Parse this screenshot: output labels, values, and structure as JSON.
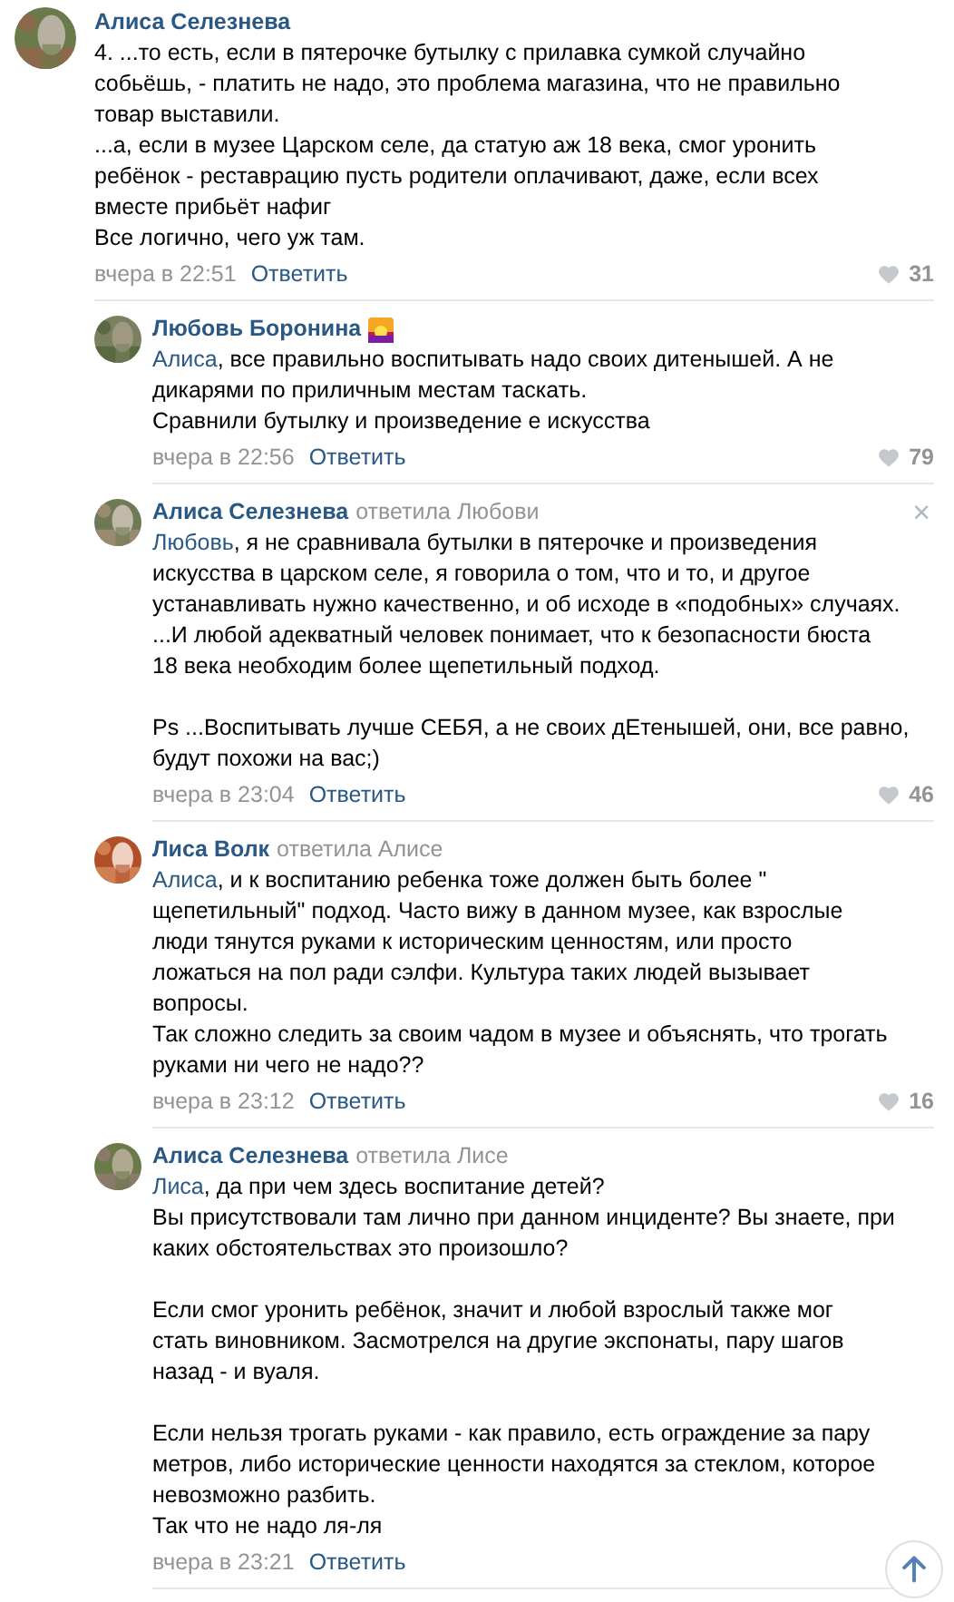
{
  "comment": {
    "author": "Алиса Селезнева",
    "avatar": {
      "kind": "picture"
    },
    "paragraphs": [
      {
        "text": "4. ...то есть, если в пятерочке бутылку с прилавка сумкой случайно\nсобьёшь, - платить не надо, это проблема магазина, что не правильно\nтовар выставили.\n...а, если в музее Царском селе, да статую аж 18 века, смог уронить\nребёнок - реставрацию пусть родители оплачивают, даже, если всех\nвместе прибьёт нафиг\nВсе логично, чего уж там."
      }
    ],
    "time": "вчера в 22:51",
    "reply": "Ответить",
    "likes": "31",
    "closable": false,
    "replies": [
      {
        "author": "Любовь Боронина",
        "closable": false,
        "avatar": {
          "kind": "picture"
        },
        "emoji": {
          "kind": "sunset"
        },
        "paragraphs": [
          {
            "mention": "Алиса",
            "text": ", все правильно воспитывать надо своих дитенышей. А не\nдикарями по приличным местам таскать.\nСравнили бутылку и произведение е искусства"
          }
        ],
        "time": "вчера в 22:56",
        "reply": "Ответить",
        "likes": "79"
      },
      {
        "author": "Алиса Селезнева",
        "reply_to": "ответила Любови",
        "closable": true,
        "close": "×",
        "avatar": {
          "kind": "picture"
        },
        "paragraphs": [
          {
            "mention": "Любовь",
            "text": ", я не сравнивала бутылки в пятерочке и произведения\nискусства в царском селе, я говорила о том, что и то, и другое\nустанавливать нужно качественно, и об исходе в «подобных» случаях.\n...И любой адекватный человек понимает, что к безопасности бюста\n18 века необходим более щепетильный подход."
          },
          {
            "text": "Ps ...Воспитывать лучше СЕБЯ, а не своих дЕтенышей, они, все равно,\nбудут похожи на вас;)"
          }
        ],
        "time": "вчера в 23:04",
        "reply": "Ответить",
        "likes": "46"
      },
      {
        "author": "Лиса Волк",
        "reply_to": "ответила Алисе",
        "closable": false,
        "avatar": {
          "kind": "picture"
        },
        "paragraphs": [
          {
            "mention": "Алиса",
            "text": ", и к воспитанию ребенка тоже должен быть более \"\nщепетильный\" подход. Часто вижу в данном музее, как взрослые\nлюди тянутся руками к историческим ценностям, или просто\nложаться на пол ради сэлфи. Культура таких людей вызывает\nвопросы.\nТак сложно следить за своим чадом в музее и объяснять, что трогать\nруками ни чего не надо??"
          }
        ],
        "time": "вчера в 23:12",
        "reply": "Ответить",
        "likes": "16"
      },
      {
        "author": "Алиса Селезнева",
        "reply_to": "ответила Лисе",
        "closable": false,
        "avatar": {
          "kind": "picture"
        },
        "paragraphs": [
          {
            "mention": "Лиса",
            "text": ", да при чем здесь воспитание детей?\nВы присутствовали там лично при данном инциденте? Вы знаете, при\nкаких обстоятельствах это произошло?"
          },
          {
            "text": "Если смог уронить ребёнок, значит и любой взрослый также мог\nстать виновником. Засмотрелся на другие экспонаты, пару шагов\nназад - и вуаля."
          },
          {
            "text": "Если нельзя трогать руками - как правило, есть ограждение за пару\nметров, либо исторические ценности находятся за стеклом, которое\nневозможно разбить.\nТак что не надо ля-ля"
          }
        ],
        "time": "вчера в 23:21",
        "reply": "Ответить"
      }
    ]
  },
  "scroll_top": {
    "shown": true
  }
}
